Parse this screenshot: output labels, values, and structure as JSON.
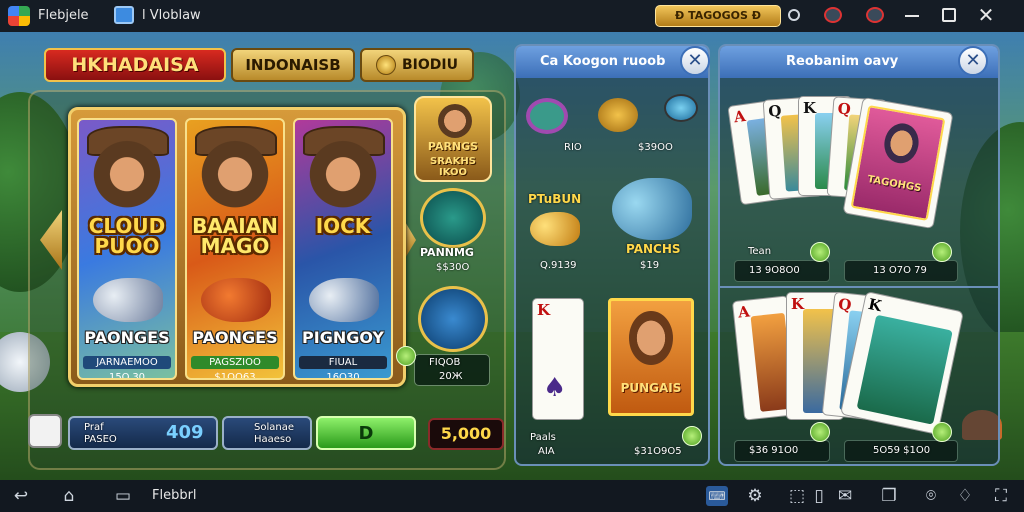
{
  "topbar": {
    "app_name": "Flebjele",
    "tab_title": "l Vloblaw",
    "coin_badge": "Ð TAGOGOS Ð",
    "icons": [
      "window-icon",
      "info-icon",
      "camera-icon",
      "record-icon",
      "minimize-icon",
      "restore-icon",
      "close-icon"
    ]
  },
  "header": {
    "main_title": "HKHADAISA",
    "tab_indonesia": "INDONAISB",
    "tab_gold": "BIODIU"
  },
  "slot_cards": [
    {
      "title": "CLOUD PUOO",
      "caption": "PAONGES",
      "label": "JARNAEMOO",
      "value": "15O.30",
      "theme": "#6a4fb0",
      "label_color": "#1f4a7a"
    },
    {
      "title": "BAAIAN MAGO",
      "caption": "PAONGES",
      "label": "PAGSZIOO",
      "value": "$1OO63",
      "theme": "#d95a18",
      "label_color": "#2f8a2a"
    },
    {
      "title": "IOCK",
      "caption": "PIGNGOY",
      "label": "FIUAL",
      "value": "16O30",
      "theme": "#2a55a8",
      "label_color": "#1a2a40"
    }
  ],
  "side_items": {
    "badge_title": "PARNGS",
    "badge_subtitle": "SRAKHS IKOO",
    "medal1_label": "PANNMG",
    "medal1_value": "$$30O",
    "medal2_value1": "FIQOB",
    "medal2_value2": "20Ж"
  },
  "bottom_controls": {
    "label_left_1": "Praf",
    "label_left_2": "PASEO",
    "bet_value": "409",
    "label_mid_1": "Solanae",
    "label_mid_2": "Haaeso",
    "spin_label": "D",
    "balance": "5,000"
  },
  "middle_panel": {
    "title": "Ca Koogon ruoob",
    "item1_value": "RIO",
    "item2_value": "$39OO",
    "fish_label": "PTuBUN",
    "fish_value": "Q.9139",
    "fish2_label": "PANCHS",
    "fish2_value": "$19",
    "portrait_label": "PUNGAIS",
    "bottom_label1": "Paals",
    "bottom_label2": "AIA",
    "bottom_value": "$31O9O5"
  },
  "right_panel": {
    "title": "Reobanim oavy",
    "row1_label": "Tean",
    "row1_value": "13 9O8O0",
    "row2_value": "13 O7O 79",
    "card_art_text": "TAGOHGS",
    "row3_value": "$36 91O0",
    "row4_value": "5O59 $1O0"
  },
  "navbar": {
    "label": "Flebbrl",
    "icons": [
      "back-icon",
      "home-icon",
      "recent-apps-icon",
      "keyboard-icon",
      "settings-icon",
      "screenshot-icon",
      "phone-icon",
      "mail-icon",
      "multi-window-icon",
      "location-icon",
      "fullscreen-icon"
    ]
  }
}
